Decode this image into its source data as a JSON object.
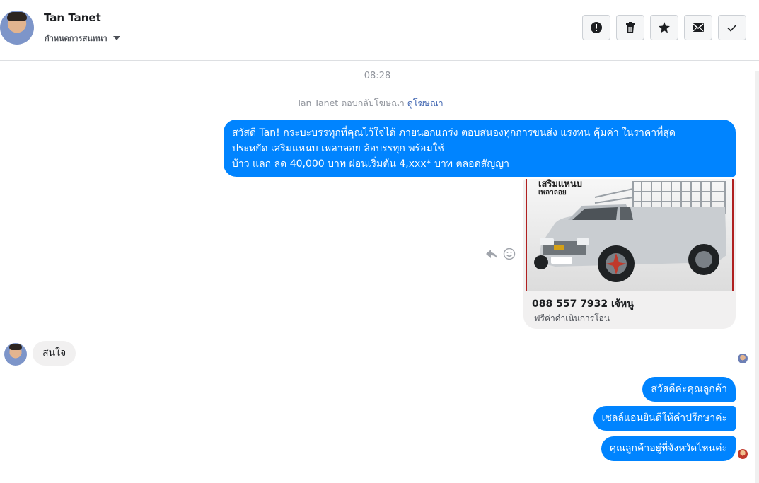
{
  "header": {
    "contact_name": "Tan Tanet",
    "conversation_settings": "กำหนดการสนทนา",
    "actions": [
      {
        "name": "mark-spam-button",
        "icon": "exclamation-icon"
      },
      {
        "name": "delete-button",
        "icon": "trash-icon"
      },
      {
        "name": "star-button",
        "icon": "star-icon"
      },
      {
        "name": "mark-unread-button",
        "icon": "envelope-icon"
      },
      {
        "name": "mark-done-button",
        "icon": "checkmark-icon"
      }
    ]
  },
  "thread": {
    "timestamp": "08:28",
    "ad_reply_note": "Tan Tanet ตอบกลับโฆษณา",
    "ad_link": "ดูโฆษณา",
    "ad_message_lines": [
      "สวัสดี Tan! กระบะบรรทุกที่คุณไว้ใจได้ ภายนอกแกร่ง ตอบสนองทุกการขนส่ง แรงทน คุ้มค่า ในราคาที่สุด",
      "ประหยัด เสริมแหนบ เพลาลอย ล้อบรรทุก พร้อมใช้",
      "บ้าว แลก ลด 40,000 บาท ผ่อนเริ่มต้น 4,xxx* บาท ตลอดสัญญา"
    ],
    "ad_card": {
      "image_headline": "เสริมแหนบ",
      "image_subline": "เพลาลอย",
      "title": "088 557 7932 เจ้หนู",
      "description": "ฟรีค่าดำเนินการโอน"
    },
    "incoming_message": "สนใจ",
    "replies": [
      "สวัสดีค่ะคุณลูกค้า",
      "เซลล์แอนยินดีให้คำปรึกษาค่ะ",
      "คุณลูกค้าอยู่ที่จังหวัดไหนค่ะ"
    ]
  },
  "colors": {
    "outgoing_bubble": "#0084ff",
    "incoming_bubble": "#f1f0f0",
    "link": "#4267b2",
    "muted_text": "#90949c"
  }
}
